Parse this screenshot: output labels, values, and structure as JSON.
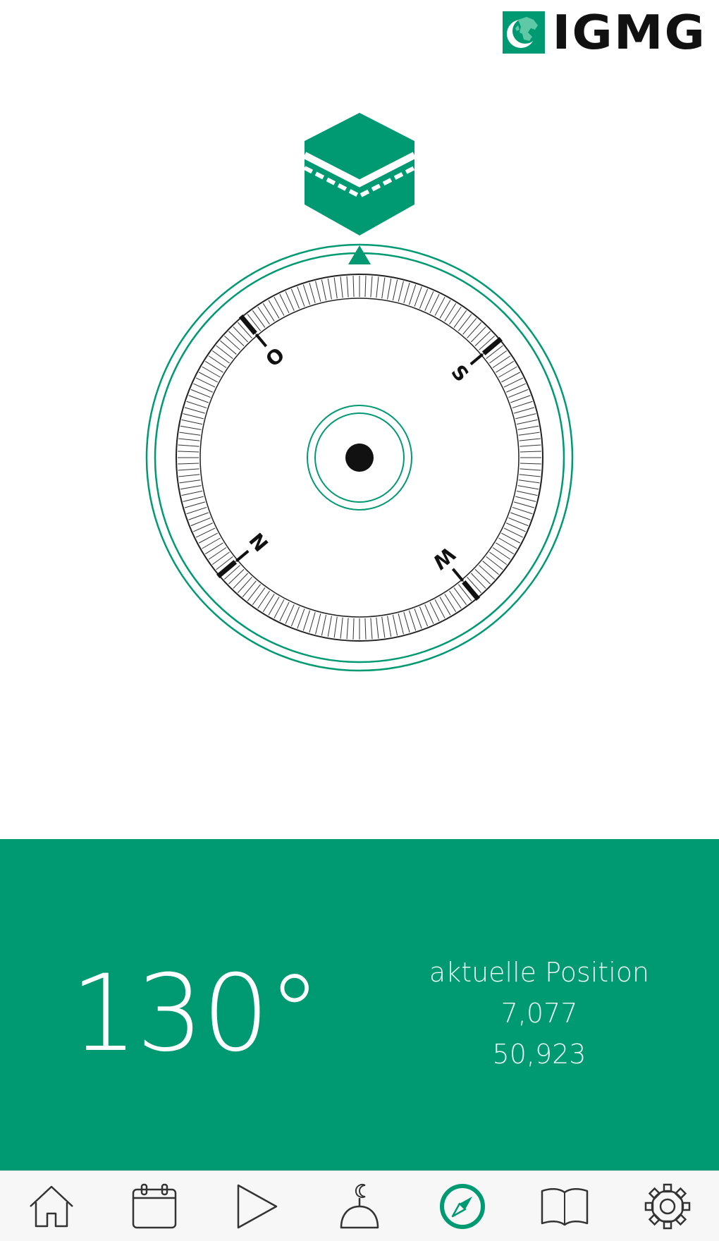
{
  "brand": {
    "name": "IGMG",
    "color": "#009A72"
  },
  "qibla": {
    "heading": "130°",
    "position_label": "aktuelle Position",
    "longitude": "7,077",
    "latitude": "50,923"
  },
  "compass": {
    "cardinals": [
      "N",
      "O",
      "S",
      "W"
    ],
    "ring_color": "#009A72"
  },
  "nav": {
    "items": [
      {
        "icon": "home-icon",
        "active": false
      },
      {
        "icon": "calendar-icon",
        "active": false
      },
      {
        "icon": "play-icon",
        "active": false
      },
      {
        "icon": "crescent-dome-icon",
        "active": false
      },
      {
        "icon": "compass-icon",
        "active": true
      },
      {
        "icon": "book-icon",
        "active": false
      },
      {
        "icon": "gear-icon",
        "active": false
      }
    ]
  }
}
